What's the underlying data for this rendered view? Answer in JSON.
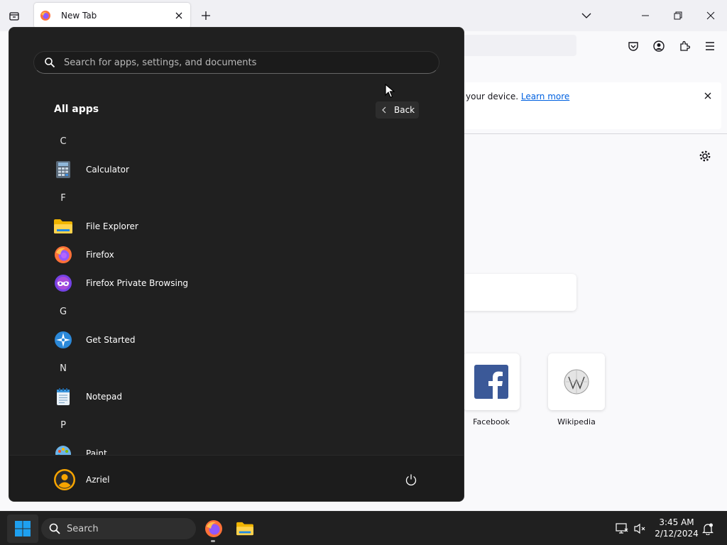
{
  "firefox": {
    "tab": {
      "title": "New Tab"
    },
    "notice": {
      "text": "your device. ",
      "link": "Learn more"
    },
    "shortcuts": [
      {
        "label": "Facebook"
      },
      {
        "label": "Wikipedia"
      }
    ]
  },
  "start_menu": {
    "search_placeholder": "Search for apps, settings, and documents",
    "heading": "All apps",
    "back_label": "Back",
    "apps": [
      {
        "kind": "letter",
        "text": "C"
      },
      {
        "kind": "app",
        "text": "Calculator",
        "icon": "calculator-icon"
      },
      {
        "kind": "letter",
        "text": "F"
      },
      {
        "kind": "app",
        "text": "File Explorer",
        "icon": "file-explorer-icon"
      },
      {
        "kind": "app",
        "text": "Firefox",
        "icon": "firefox-icon"
      },
      {
        "kind": "app",
        "text": "Firefox Private Browsing",
        "icon": "firefox-private-icon"
      },
      {
        "kind": "letter",
        "text": "G"
      },
      {
        "kind": "app",
        "text": "Get Started",
        "icon": "get-started-icon"
      },
      {
        "kind": "letter",
        "text": "N"
      },
      {
        "kind": "app",
        "text": "Notepad",
        "icon": "notepad-icon"
      },
      {
        "kind": "letter",
        "text": "P"
      },
      {
        "kind": "app",
        "text": "Paint",
        "icon": "paint-icon"
      }
    ],
    "user": {
      "name": "Azriel"
    }
  },
  "taskbar": {
    "search_label": "Search",
    "time": "3:45 AM",
    "date": "2/12/2024"
  },
  "colors": {
    "start_bg": "#202020",
    "taskbar_bg": "#202020",
    "windows_blue": "#1ea0f0",
    "link_blue": "#0061e0"
  }
}
